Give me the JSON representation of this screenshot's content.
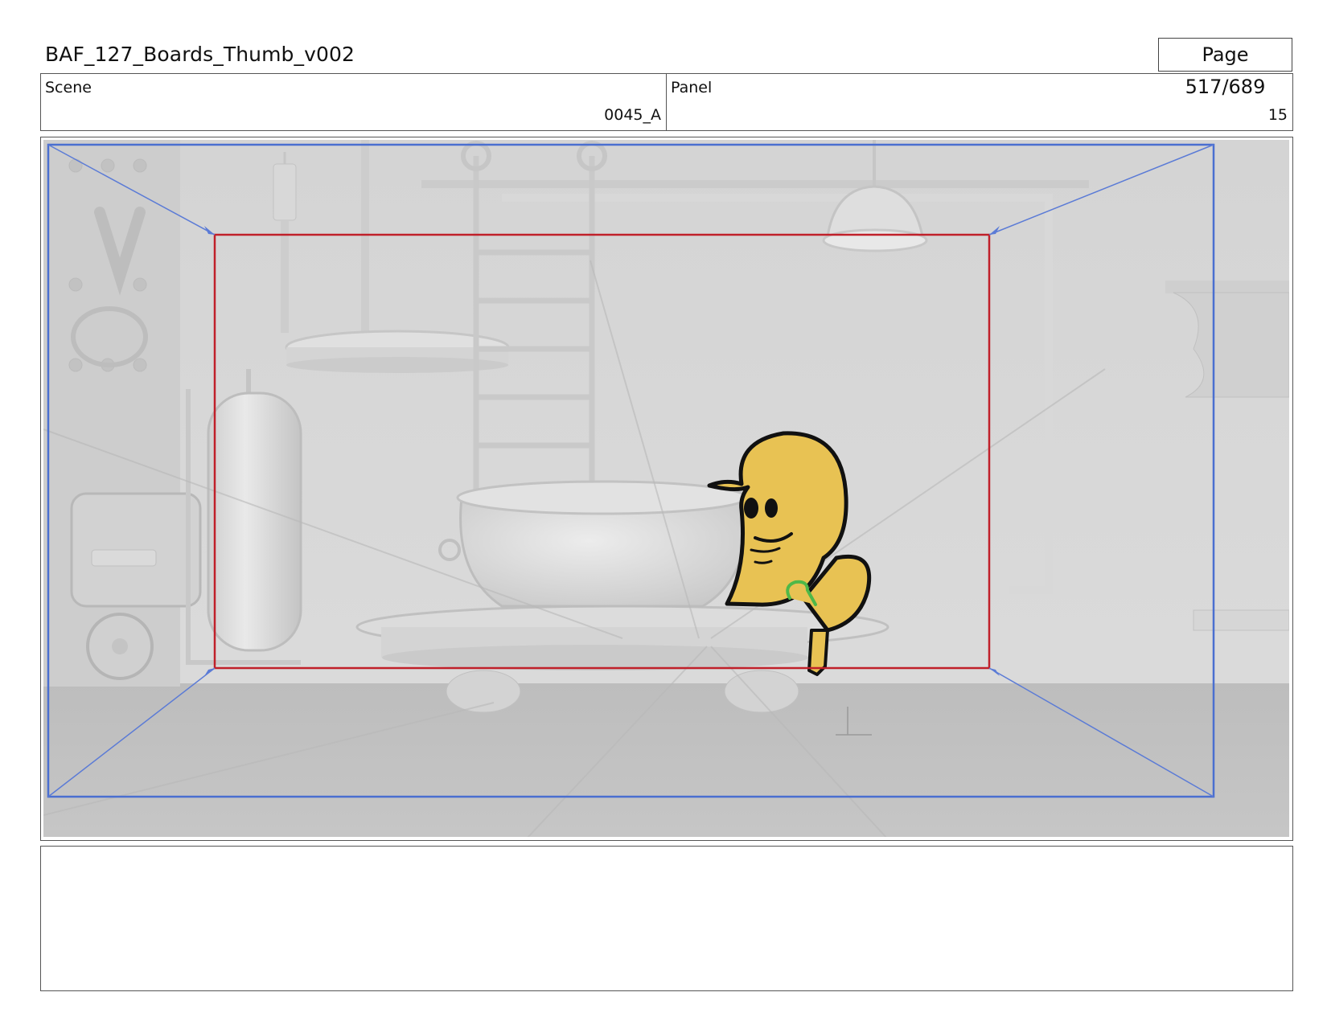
{
  "header": {
    "document_title": "BAF_127_Boards_Thumb_v002",
    "page_counter": "Page 517/689"
  },
  "info": {
    "scene_label": "Scene",
    "scene_value": "0045_A",
    "panel_label": "Panel",
    "panel_value": "15"
  },
  "frame": {
    "safe_area_color": "#c0202a",
    "field_guide_color": "#4a6fd0",
    "character_color": "#e8c253",
    "icons": [
      "camera-field-guide-icon",
      "yellow-bird-character-icon",
      "cauldron-prop-icon",
      "gas-cylinder-prop-icon",
      "ladder-prop-icon",
      "hanging-lamp-prop-icon"
    ]
  },
  "notes": {
    "text": ""
  }
}
